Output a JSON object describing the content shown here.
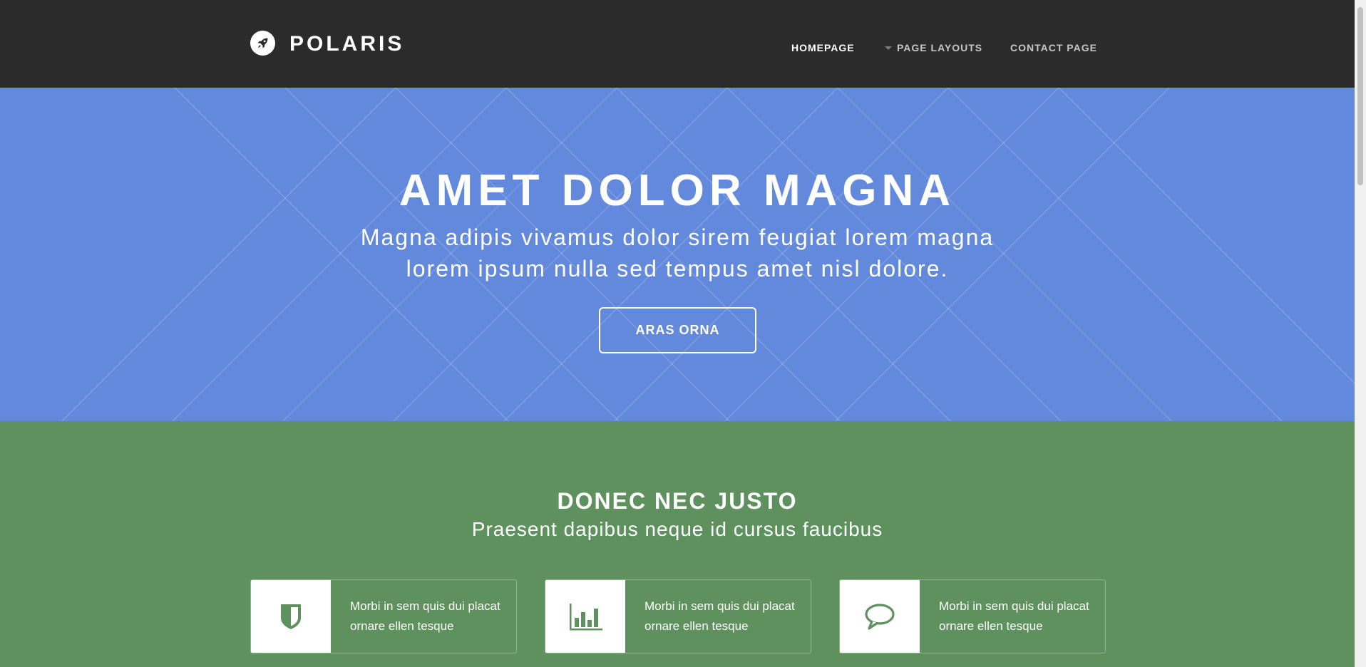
{
  "header": {
    "logo_text": "POLARIS",
    "logo_icon": "rocket-icon",
    "nav": [
      {
        "label": "HOMEPAGE",
        "active": true
      },
      {
        "label": "PAGE LAYOUTS",
        "has_dropdown": true
      },
      {
        "label": "CONTACT PAGE"
      }
    ]
  },
  "hero": {
    "title": "AMET DOLOR MAGNA",
    "subtitle_line1": "Magna adipis vivamus dolor sirem feugiat lorem magna",
    "subtitle_line2": "lorem ipsum nulla sed tempus amet nisl dolore.",
    "button_label": "ARAS ORNA",
    "background_color": "#6289db"
  },
  "features": {
    "title": "DONEC NEC JUSTO",
    "subtitle": "Praesent dapibus neque id cursus faucibus",
    "background_color": "#5e915e",
    "cards": [
      {
        "icon": "shield-icon",
        "text": "Morbi in sem quis dui placat ornare ellen tesque"
      },
      {
        "icon": "bar-chart-icon",
        "text": "Morbi in sem quis dui placat ornare ellen tesque"
      },
      {
        "icon": "comment-icon",
        "text": "Morbi in sem quis dui placat ornare ellen tesque"
      }
    ]
  },
  "colors": {
    "header_bg": "#2b2b2b",
    "hero_bg": "#6289db",
    "features_bg": "#5e915e",
    "icon_green": "#5e915e"
  }
}
